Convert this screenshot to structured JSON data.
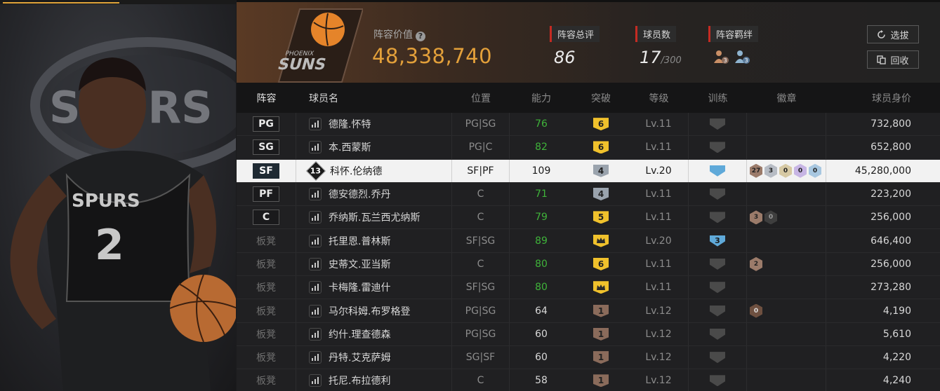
{
  "header": {
    "team_logo_text": "PHOENIX SUNS",
    "lineup_value_label": "阵容价值",
    "lineup_value": "48,338,740",
    "overall_label": "阵容总评",
    "overall_value": "86",
    "players_label": "球员数",
    "players_count": "17",
    "players_max": "/300",
    "bond_label": "阵容羁绊",
    "bond_counts": [
      "3",
      "3"
    ],
    "select_button": "选拔",
    "recycle_button": "回收"
  },
  "player_image": {
    "jersey_text": "SPURS",
    "jersey_number": "2",
    "background_text": "SPURS"
  },
  "table": {
    "columns": [
      "阵容",
      "球员名",
      "位置",
      "能力",
      "突破",
      "等级",
      "训练",
      "徽章",
      "球员身价"
    ],
    "rows": [
      {
        "slot": "PG",
        "name": "德隆.怀特",
        "pos": "PG|SG",
        "ability": "76",
        "break": "6",
        "level": "Lv.11",
        "value": "732,800"
      },
      {
        "slot": "SG",
        "name": "本.西蒙斯",
        "pos": "PG|C",
        "ability": "82",
        "break": "6",
        "level": "Lv.11",
        "value": "652,800"
      },
      {
        "slot": "SF",
        "name": "科怀.伦纳德",
        "number": "13",
        "pos": "SF|PF",
        "ability": "109",
        "break": "4",
        "level": "Lv.20",
        "value": "45,280,000",
        "badges": [
          "27",
          "3",
          "0",
          "0",
          "0"
        ]
      },
      {
        "slot": "PF",
        "name": "德安德烈.乔丹",
        "pos": "C",
        "ability": "71",
        "break": "4",
        "level": "Lv.11",
        "value": "223,200"
      },
      {
        "slot": "C",
        "name": "乔纳斯.瓦兰西尤纳斯",
        "pos": "C",
        "ability": "79",
        "break": "5",
        "level": "Lv.11",
        "value": "256,000",
        "badges": [
          "3",
          "0"
        ]
      },
      {
        "slot": "板凳",
        "name": "托里恩.普林斯",
        "pos": "SF|SG",
        "ability": "89",
        "break": "crown",
        "level": "Lv.20",
        "train": "3",
        "value": "646,400"
      },
      {
        "slot": "板凳",
        "name": "史蒂文.亚当斯",
        "pos": "C",
        "ability": "80",
        "break": "6",
        "level": "Lv.11",
        "value": "256,000",
        "badges": [
          "2"
        ]
      },
      {
        "slot": "板凳",
        "name": "卡梅隆.雷迪什",
        "pos": "SF|SG",
        "ability": "80",
        "break": "crown",
        "level": "Lv.11",
        "value": "273,280"
      },
      {
        "slot": "板凳",
        "name": "马尔科姆.布罗格登",
        "pos": "PG|SG",
        "ability": "64",
        "break": "1",
        "level": "Lv.12",
        "value": "4,190",
        "badges": [
          "0"
        ]
      },
      {
        "slot": "板凳",
        "name": "约什.理查德森",
        "pos": "PG|SG",
        "ability": "60",
        "break": "1",
        "level": "Lv.12",
        "value": "5,610"
      },
      {
        "slot": "板凳",
        "name": "丹特.艾克萨姆",
        "pos": "SG|SF",
        "ability": "60",
        "break": "1",
        "level": "Lv.12",
        "value": "4,220"
      },
      {
        "slot": "板凳",
        "name": "托尼.布拉德利",
        "pos": "C",
        "ability": "58",
        "break": "1",
        "level": "Lv.12",
        "value": "4,240"
      }
    ]
  }
}
